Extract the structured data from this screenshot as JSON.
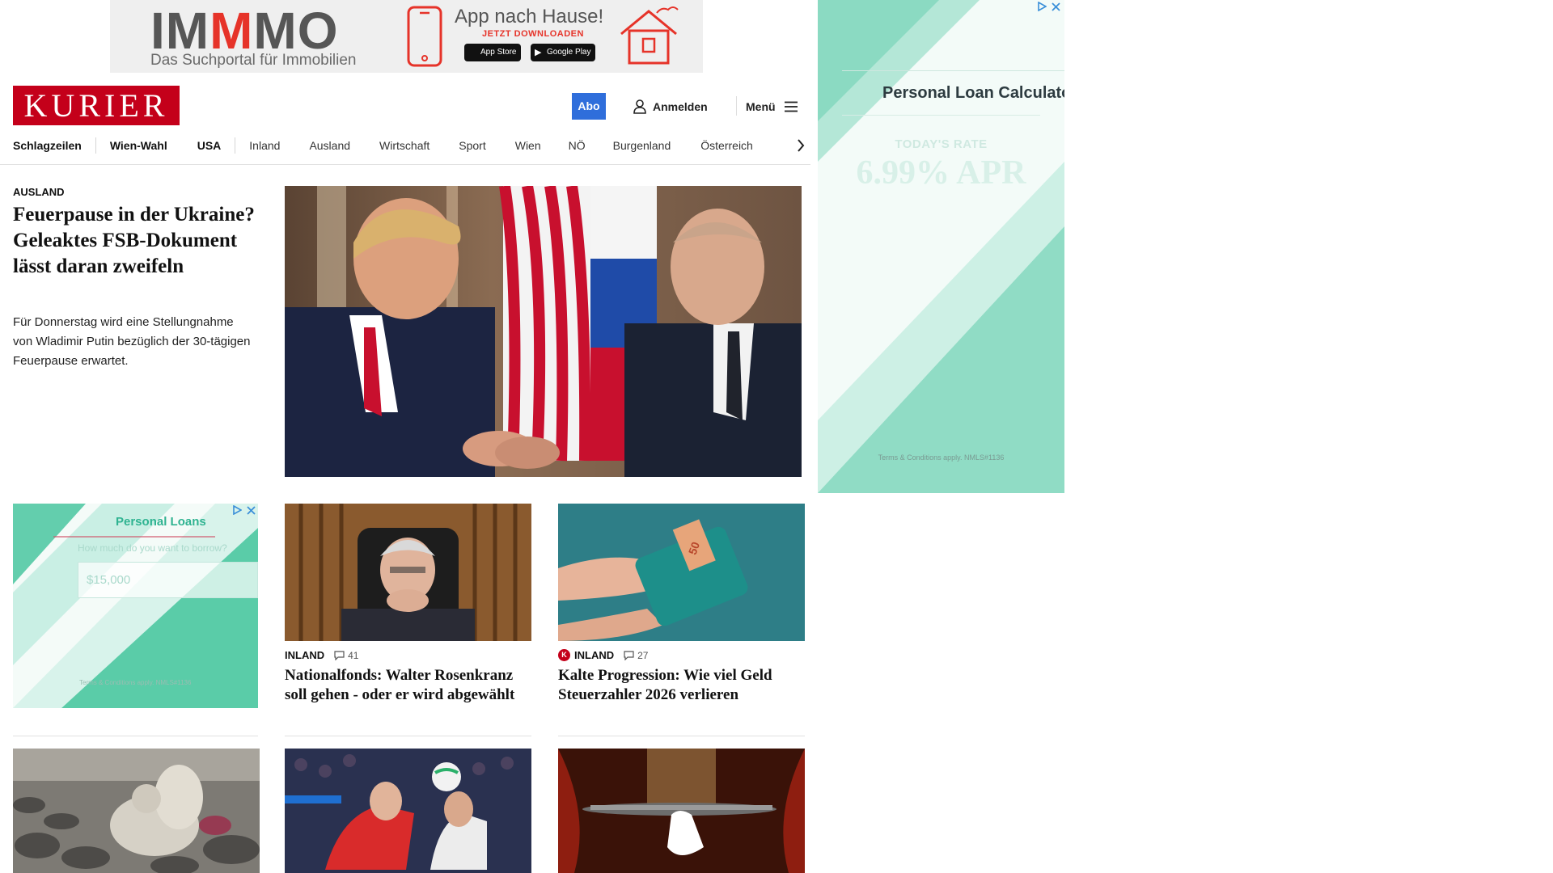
{
  "banner": {
    "logo_pre": "IM",
    "logo_mid": "M",
    "logo_post": "MO",
    "tagline": "Das Suchportal für Immobilien",
    "headline": "App nach Hause!",
    "cta": "JETZT DOWNLOADEN",
    "app_store": "App Store",
    "google_play": "Google Play"
  },
  "header": {
    "logo": "KURIER",
    "abo": "Abo",
    "login": "Anmelden",
    "menu": "Menü"
  },
  "nav": {
    "items": [
      "Schlagzeilen",
      "Wien-Wahl",
      "USA",
      "Inland",
      "Ausland",
      "Wirtschaft",
      "Sport",
      "Wien",
      "NÖ",
      "Burgenland",
      "Österreich"
    ]
  },
  "lead": {
    "kicker": "AUSLAND",
    "title": "Feuerpause in der Ukraine? Geleaktes FSB-Dokument lässt daran zweifeln",
    "teaser": "Für Donnerstag wird eine Stellungnahme von Wladimir Putin bezüglich der 30-tägigen Feuerpause erwartet."
  },
  "ad_left": {
    "title": "Personal Loans",
    "question": "How much do you want to borrow?",
    "amount": "$15,000",
    "terms": "Terms & Conditions apply. NMLS#1136"
  },
  "cards": [
    {
      "kicker": "INLAND",
      "comments": "41",
      "title": "Nationalfonds: Walter Rosenkranz soll gehen - oder er wird abgewählt"
    },
    {
      "kicker": "INLAND",
      "comments": "27",
      "title": "Kalte Progression: Wie viel Geld Steuerzahler 2026 verlieren"
    }
  ],
  "ad_right": {
    "title": "Personal Loan Calculato",
    "rate_label": "TODAY'S RATE",
    "rate": "6.99% APR",
    "terms": "Terms & Conditions apply. NMLS#1136"
  },
  "colors": {
    "brand_red": "#c4001a",
    "abo_blue": "#2f6edb",
    "ad_mint": "#3ec39a"
  },
  "icons": [
    "phone-icon",
    "house-icon",
    "user-icon",
    "hamburger-icon",
    "chevron-right-icon",
    "comment-icon",
    "adchoices-icon",
    "close-icon"
  ]
}
